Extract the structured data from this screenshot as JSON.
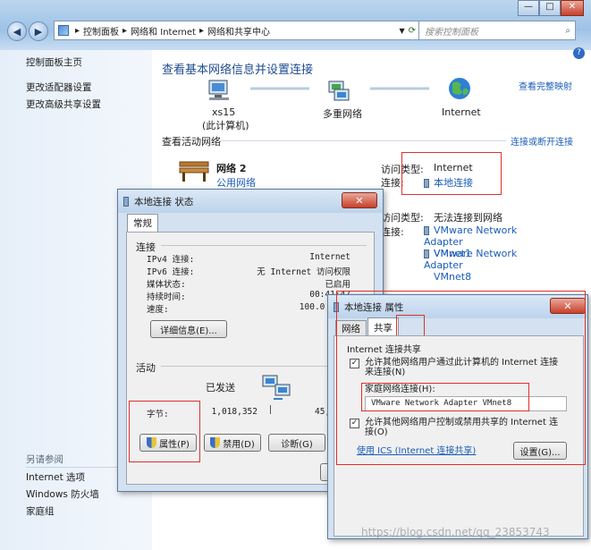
{
  "address_bar": {
    "crumbs": [
      "控制面板",
      "网络和 Internet",
      "网络和共享中心"
    ],
    "search_placeholder": "搜索控制面板"
  },
  "sidebar": {
    "home": "控制面板主页",
    "items": [
      "更改适配器设置",
      "更改高级共享设置"
    ],
    "see_also_title": "另请参阅",
    "see_also": [
      "Internet 选项",
      "Windows 防火墙",
      "家庭组"
    ]
  },
  "main": {
    "title": "查看基本网络信息并设置连接",
    "view_full_map": "查看完整映射",
    "nodes": {
      "computer": "xs15",
      "computer_sub": "(此计算机)",
      "multi": "多重网络",
      "internet": "Internet"
    },
    "active_networks_label": "查看活动网络",
    "connect_disconnect": "连接或断开连接",
    "network1": {
      "name": "网络  2",
      "type": "公用网络",
      "access_type_label": "访问类型:",
      "access_type_value": "Internet",
      "connection_label": "连接:",
      "connection_value": "本地连接"
    },
    "network2": {
      "access_type_label": "访问类型:",
      "access_type_value": "无法连接到网络",
      "connection_label": "连接:",
      "connections": [
        "VMware Network Adapter",
        "VMnet1",
        "VMware Network Adapter",
        "VMnet8"
      ]
    }
  },
  "status_dialog": {
    "title": "本地连接 状态",
    "tab": "常规",
    "connection_section": "连接",
    "rows": [
      {
        "label": "IPv4 连接:",
        "value": "Internet"
      },
      {
        "label": "IPv6 连接:",
        "value": "无 Internet 访问权限"
      },
      {
        "label": "媒体状态:",
        "value": "已启用"
      },
      {
        "label": "持续时间:",
        "value": "00:41:47"
      },
      {
        "label": "速度:",
        "value": "100.0 Mbps"
      }
    ],
    "details_button": "详细信息(E)...",
    "activity_section": "活动",
    "sent_label": "已发送",
    "bytes_label": "字节:",
    "bytes_sent": "1,018,352",
    "bytes_received": "45,3",
    "properties_button": "属性(P)",
    "disable_button": "禁用(D)",
    "diagnose_button": "诊断(G)"
  },
  "properties_dialog": {
    "title": "本地连接 属性",
    "tabs": [
      "网络",
      "共享"
    ],
    "section": "Internet 连接共享",
    "allow_connect": "允许其他网络用户通过此计算机的 Internet 连接来连接(N)",
    "home_network_label": "家庭网络连接(H):",
    "home_network_value": "VMware Network Adapter VMnet8",
    "allow_control": "允许其他网络用户控制或禁用共享的 Internet 连接(O)",
    "ics_link": "使用 ICS (Internet 连接共享)",
    "settings_button": "设置(G)..."
  },
  "watermark": "https://blog.csdn.net/qq_23853743"
}
